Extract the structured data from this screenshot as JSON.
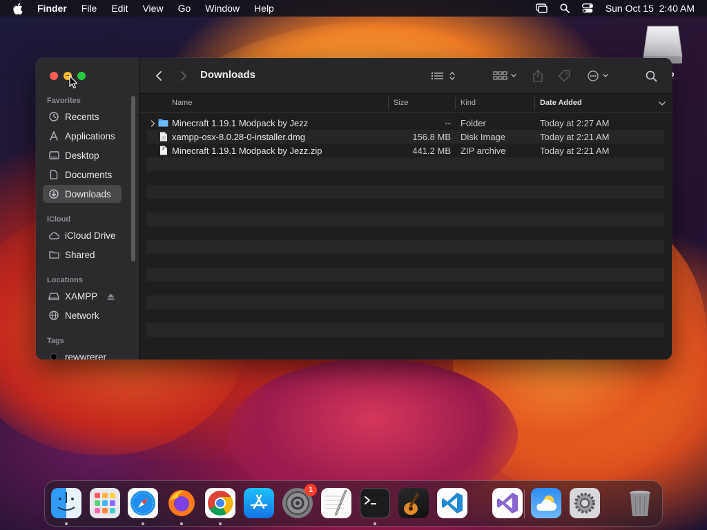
{
  "menubar": {
    "app_name": "Finder",
    "items": [
      "File",
      "Edit",
      "View",
      "Go",
      "Window",
      "Help"
    ],
    "clock": "Sun Oct 15  2:40 AM"
  },
  "desktop": {
    "drive_label": "P"
  },
  "finder": {
    "title": "Downloads",
    "sidebar": {
      "favorites_header": "Favorites",
      "favorites": [
        {
          "label": "Recents",
          "icon": "clock-icon"
        },
        {
          "label": "Applications",
          "icon": "applications-icon"
        },
        {
          "label": "Desktop",
          "icon": "desktop-icon"
        },
        {
          "label": "Documents",
          "icon": "document-icon"
        },
        {
          "label": "Downloads",
          "icon": "download-icon",
          "selected": true
        }
      ],
      "icloud_header": "iCloud",
      "icloud": [
        {
          "label": "iCloud Drive",
          "icon": "cloud-icon"
        },
        {
          "label": "Shared",
          "icon": "shared-folder-icon"
        }
      ],
      "locations_header": "Locations",
      "locations": [
        {
          "label": "XAMPP",
          "icon": "drive-icon",
          "ejectable": true
        },
        {
          "label": "Network",
          "icon": "globe-icon"
        }
      ],
      "tags_header": "Tags",
      "tags": [
        {
          "label": "rewwrerer",
          "color": "#000000"
        }
      ]
    },
    "columns": {
      "name": "Name",
      "size": "Size",
      "kind": "Kind",
      "date_added": "Date Added"
    },
    "files": [
      {
        "name": "Minecraft 1.19.1 Modpack by Jezz",
        "size": "--",
        "kind": "Folder",
        "date_added": "Today at 2:27 AM",
        "type": "folder"
      },
      {
        "name": "xampp-osx-8.0.28-0-installer.dmg",
        "size": "156.8 MB",
        "kind": "Disk Image",
        "date_added": "Today at 2:21 AM",
        "type": "file"
      },
      {
        "name": "Minecraft 1.19.1 Modpack by Jezz.zip",
        "size": "441.2 MB",
        "kind": "ZIP archive",
        "date_added": "Today at 2:21 AM",
        "type": "file"
      }
    ]
  },
  "dock": {
    "apps": [
      {
        "name": "finder-app",
        "running": true
      },
      {
        "name": "launchpad-app",
        "running": false
      },
      {
        "name": "safari-app",
        "running": true
      },
      {
        "name": "firefox-app",
        "running": true
      },
      {
        "name": "chrome-app",
        "running": true
      },
      {
        "name": "app-store-app",
        "running": false
      },
      {
        "name": "system-preferences-app",
        "running": false,
        "badge": "1"
      },
      {
        "name": "textedit-app",
        "running": false
      },
      {
        "name": "terminal-app",
        "running": true
      },
      {
        "name": "garageband-app",
        "running": false
      },
      {
        "name": "vscode-app",
        "running": false
      },
      {
        "name": "visual-studio-app",
        "running": false
      },
      {
        "name": "weather-app",
        "running": false
      },
      {
        "name": "system-settings-app",
        "running": false
      },
      {
        "name": "trash-app",
        "running": false
      }
    ]
  }
}
